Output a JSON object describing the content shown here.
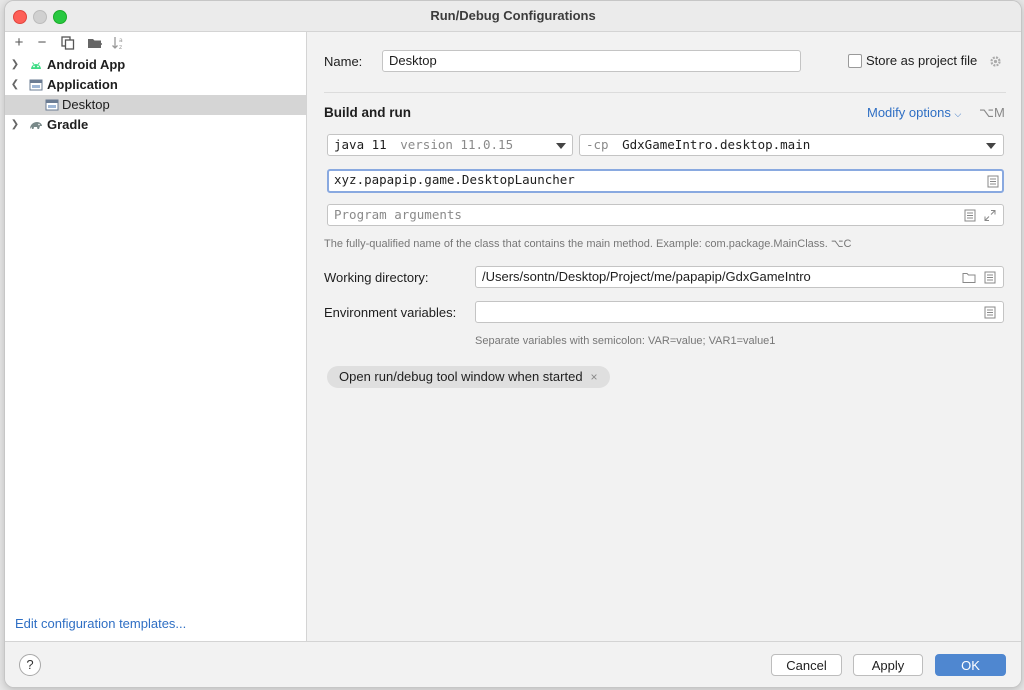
{
  "window": {
    "title": "Run/Debug Configurations"
  },
  "sidebar": {
    "toolbar": [
      {
        "name": "add-icon",
        "glyph": "+"
      },
      {
        "name": "remove-icon",
        "glyph": "−"
      },
      {
        "name": "copy-icon",
        "glyph": ""
      },
      {
        "name": "new-folder-icon",
        "glyph": ""
      },
      {
        "name": "sort-icon",
        "glyph": ""
      }
    ],
    "items": [
      {
        "label": "Android App",
        "icon": "android-icon",
        "expanded": false
      },
      {
        "label": "Application",
        "icon": "application-icon",
        "expanded": true
      },
      {
        "label": "Desktop",
        "icon": "application-config-icon",
        "selected": true
      },
      {
        "label": "Gradle",
        "icon": "gradle-elephant-icon",
        "expanded": false
      }
    ],
    "edit_templates": "Edit configuration templates..."
  },
  "form": {
    "name_label": "Name:",
    "name_value": "Desktop",
    "store_label": "Store as project file",
    "section_title": "Build and run",
    "modify_options": "Modify options",
    "modify_shortcut": "⌥M",
    "jdk_main": "java 11",
    "jdk_version": "version 11.0.15",
    "cp_prefix": "-cp",
    "cp_value": "GdxGameIntro.desktop.main",
    "main_class": "xyz.papapip.game.DesktopLauncher",
    "program_args_placeholder": "Program arguments",
    "main_class_hint": "The fully-qualified name of the class that contains the main method. Example: com.package.MainClass. ⌥C",
    "working_dir_label": "Working directory:",
    "working_dir_value": "/Users/sontn/Desktop/Project/me/papapip/GdxGameIntro",
    "env_label": "Environment variables:",
    "env_value": "",
    "env_hint": "Separate variables with semicolon: VAR=value; VAR1=value1",
    "chip_label": "Open run/debug tool window when started",
    "chip_close": "×"
  },
  "footer": {
    "help": "?",
    "cancel": "Cancel",
    "apply": "Apply",
    "ok": "OK"
  },
  "colors": {
    "accent": "#4f87d0",
    "link": "#2f6fc4",
    "selection": "#d5d5d5"
  }
}
